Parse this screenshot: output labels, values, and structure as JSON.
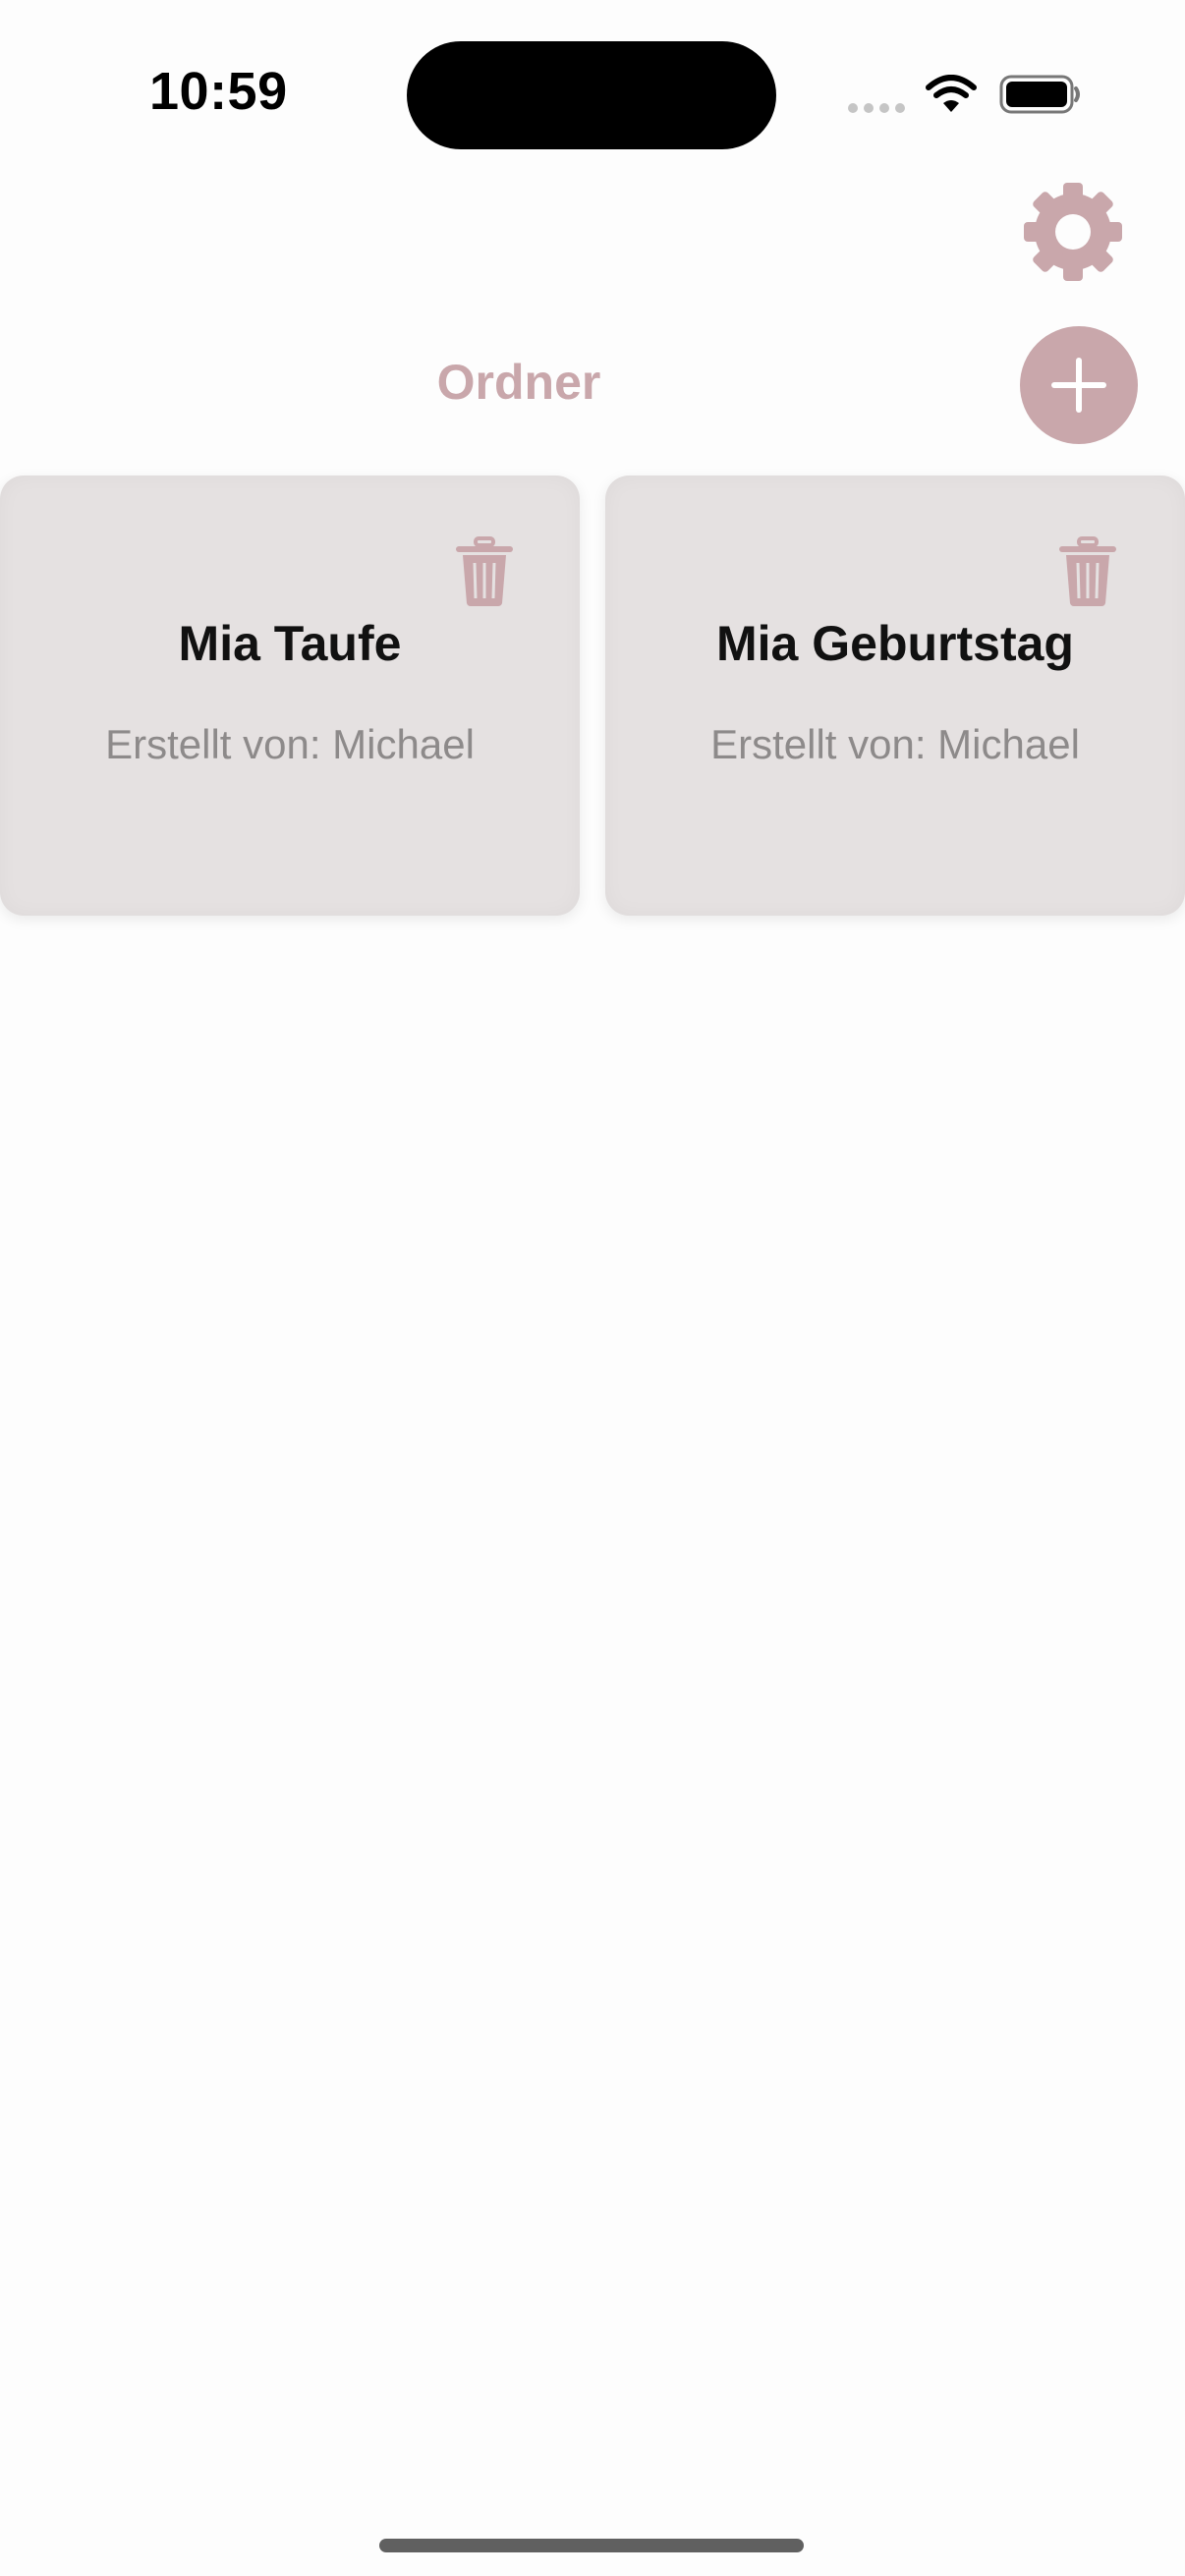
{
  "status_bar": {
    "time": "10:59"
  },
  "header": {
    "title": "Ordner",
    "settings_icon": "gear-icon",
    "add_icon": "plus-icon"
  },
  "folders": [
    {
      "name": "Mia Taufe",
      "creator": "Erstellt von: Michael",
      "delete_icon": "trash-icon"
    },
    {
      "name": "Mia Geburtstag",
      "creator": "Erstellt von: Michael",
      "delete_icon": "trash-icon"
    }
  ],
  "colors": {
    "accent": "#c9a7ab",
    "card_background": "#e5e1e1",
    "page_background": "#fdfdfd",
    "muted_text": "#8d8a8a"
  }
}
